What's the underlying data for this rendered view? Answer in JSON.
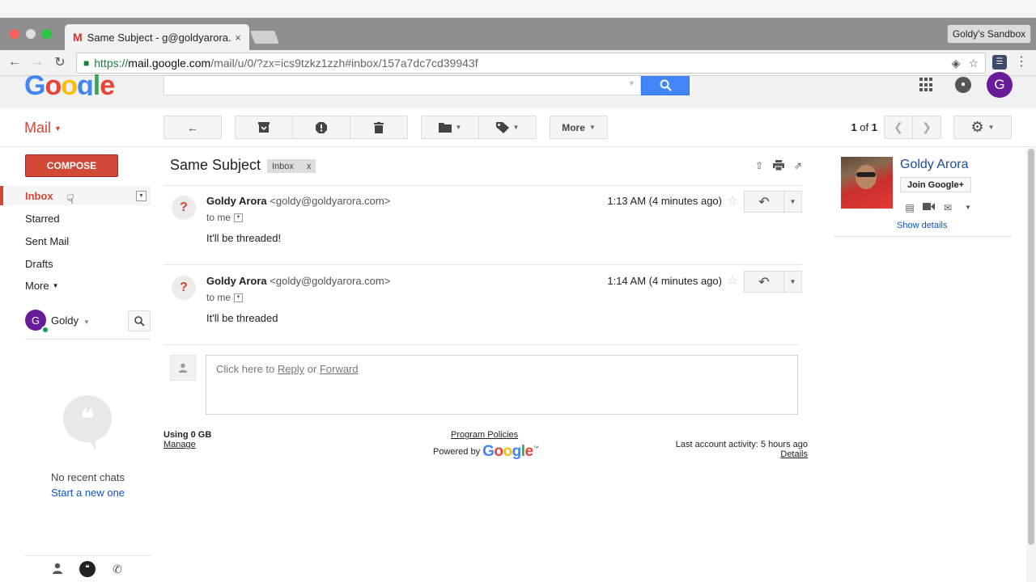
{
  "browser": {
    "tab_title": "Same Subject - g@goldyarora.",
    "tab_favicon": "M",
    "tab_close": "×",
    "profile": "Goldy's Sandbox",
    "url_secure": "https://",
    "url_host": "mail.google.com",
    "url_path": "/mail/u/0/?zx=ics9tzkz1zzh#inbox/157a7dc7cd39943f"
  },
  "header": {
    "logo": "Google",
    "logo_colors": [
      "#4285f4",
      "#ea4335",
      "#fbbc05",
      "#4285f4",
      "#34a853",
      "#ea4335"
    ],
    "avatar_letter": "G",
    "avatar_color": "#6a1b9a"
  },
  "toolbar": {
    "mail_label": "Mail",
    "more_label": "More",
    "pagination_current": "1",
    "pagination_of": "of",
    "pagination_total": "1"
  },
  "nav": {
    "compose": "COMPOSE",
    "items": [
      {
        "label": "Inbox"
      },
      {
        "label": "Starred"
      },
      {
        "label": "Sent Mail"
      },
      {
        "label": "Drafts"
      },
      {
        "label": "More"
      }
    ]
  },
  "hangouts": {
    "avatar_letter": "G",
    "name": "Goldy",
    "no_chats": "No recent chats",
    "start_new": "Start a new one"
  },
  "conversation": {
    "subject": "Same Subject",
    "label": "Inbox",
    "label_remove": "x",
    "messages": [
      {
        "sender_name": "Goldy Arora",
        "sender_email": "<goldy@goldyarora.com>",
        "to": "to me",
        "time": "1:13 AM (4 minutes ago)",
        "body": "It'll be threaded!"
      },
      {
        "sender_name": "Goldy Arora",
        "sender_email": "<goldy@goldyarora.com>",
        "to": "to me",
        "time": "1:14 AM (4 minutes ago)",
        "body": "It'll be threaded"
      }
    ],
    "reply_prefix": "Click here to",
    "reply_link": "Reply",
    "reply_or": "or",
    "forward_link": "Forward"
  },
  "footer": {
    "usage": "Using 0 GB",
    "manage": "Manage",
    "policies": "Program Policies",
    "powered_by": "Powered by",
    "google": "Google",
    "tm": "™",
    "activity": "Last account activity: 5 hours ago",
    "details": "Details"
  },
  "contact": {
    "name": "Goldy Arora",
    "join": "Join Google+",
    "show_details": "Show details"
  },
  "colors": {
    "accent_red": "#d14836",
    "search_blue": "#4285f4",
    "link_blue": "#1155cc"
  }
}
